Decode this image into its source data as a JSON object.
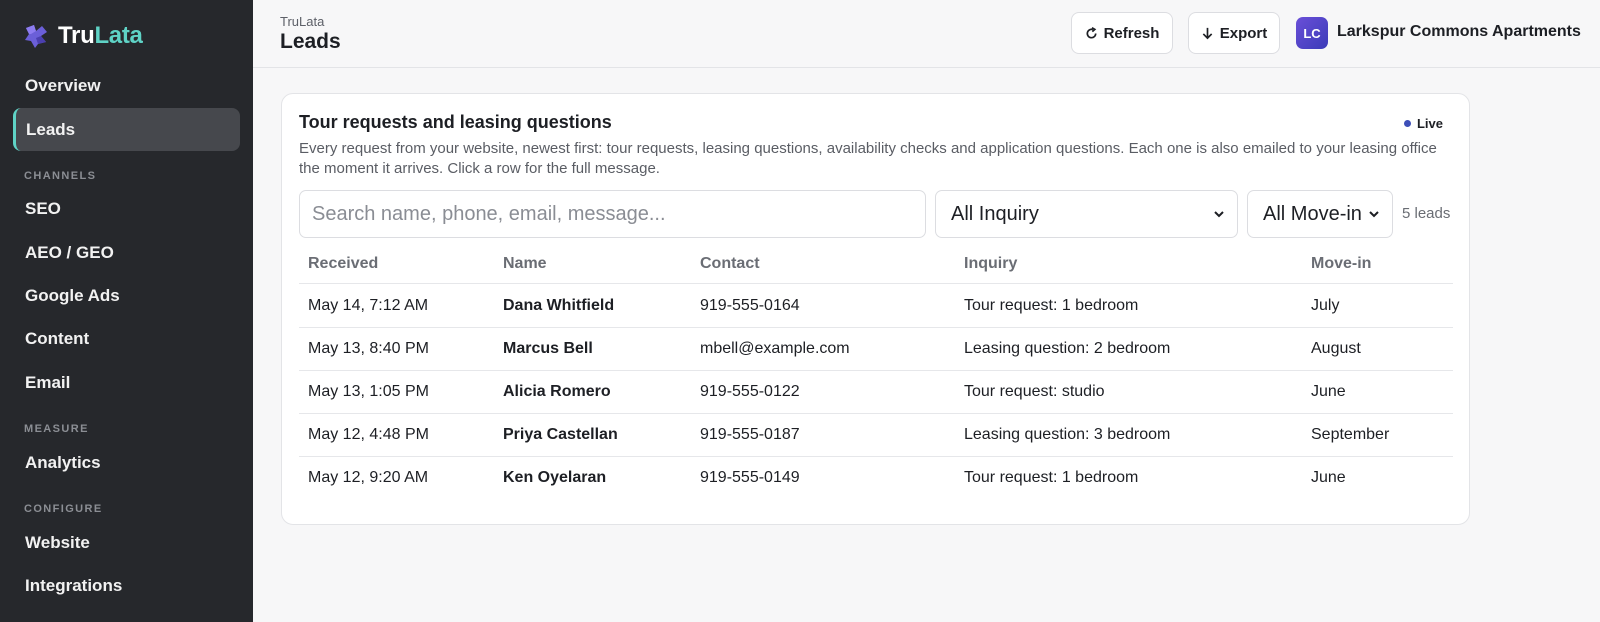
{
  "brand": {
    "part1": "Tru",
    "part2": "Lata"
  },
  "sidebar": {
    "items": [
      {
        "label": "Overview"
      },
      {
        "label": "Leads"
      },
      {
        "label": "SEO"
      },
      {
        "label": "AEO / GEO"
      },
      {
        "label": "Google Ads"
      },
      {
        "label": "Content"
      },
      {
        "label": "Email"
      },
      {
        "label": "Analytics"
      },
      {
        "label": "Website"
      },
      {
        "label": "Integrations"
      }
    ],
    "sections": [
      "CHANNELS",
      "MEASURE",
      "CONFIGURE"
    ],
    "active": "Leads"
  },
  "header": {
    "crumb": "TruLata",
    "title": "Leads",
    "refresh_label": "Refresh",
    "export_label": "Export",
    "avatar_initials": "LC",
    "property_name": "Larkspur Commons Apartments"
  },
  "card": {
    "title": "Tour requests and leasing questions",
    "live_label": "Live",
    "description": "Every request from your website, newest first: tour requests, leasing questions, availability checks and application questions. Each one is also emailed to your leasing office the moment it arrives. Click a row for the full message.",
    "search_placeholder": "Search name, phone, email, message...",
    "inquiry_filter": "All Inquiry",
    "movein_filter": "All Move-in",
    "lead_count": "5 leads"
  },
  "table": {
    "columns": [
      "Received",
      "Name",
      "Contact",
      "Inquiry",
      "Move-in"
    ],
    "rows": [
      {
        "received": "May 14, 7:12 AM",
        "name": "Dana Whitfield",
        "contact": "919-555-0164",
        "inquiry": "Tour request: 1 bedroom",
        "movein": "July"
      },
      {
        "received": "May 13, 8:40 PM",
        "name": "Marcus Bell",
        "contact": "mbell@example.com",
        "inquiry": "Leasing question: 2 bedroom",
        "movein": "August"
      },
      {
        "received": "May 13, 1:05 PM",
        "name": "Alicia Romero",
        "contact": "919-555-0122",
        "inquiry": "Tour request: studio",
        "movein": "June"
      },
      {
        "received": "May 12, 4:48 PM",
        "name": "Priya Castellan",
        "contact": "919-555-0187",
        "inquiry": "Leasing question: 3 bedroom",
        "movein": "September"
      },
      {
        "received": "May 12, 9:20 AM",
        "name": "Ken Oyelaran",
        "contact": "919-555-0149",
        "inquiry": "Tour request: 1 bedroom",
        "movein": "June"
      }
    ]
  },
  "colors": {
    "sidebar_bg": "#26282c",
    "accent": "#5fd3c6",
    "live_dot": "#3d4fb8",
    "avatar": "#5a45cc"
  },
  "icons": {
    "logo": "trulata-logo-icon",
    "refresh": "refresh-icon",
    "export": "arrow-down-icon",
    "dropdown": "chevron-down-icon"
  }
}
